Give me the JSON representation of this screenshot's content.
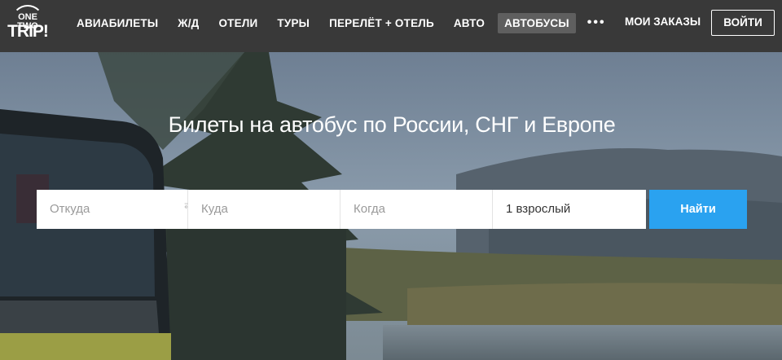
{
  "header": {
    "logo": {
      "line1": "ONE TWO",
      "line2": "TRIP!"
    },
    "nav": [
      {
        "label": "АВИАБИЛЕТЫ",
        "active": false
      },
      {
        "label": "Ж/Д",
        "active": false
      },
      {
        "label": "ОТЕЛИ",
        "active": false
      },
      {
        "label": "ТУРЫ",
        "active": false
      },
      {
        "label": "ПЕРЕЛЁТ + ОТЕЛЬ",
        "active": false
      },
      {
        "label": "АВТО",
        "active": false
      },
      {
        "label": "АВТОБУСЫ",
        "active": true
      }
    ],
    "more_icon": "more-dots-icon",
    "orders_label": "МОИ ЗАКАЗЫ",
    "login_label": "ВОЙТИ"
  },
  "hero": {
    "title": "Билеты на автобус по России, СНГ и Европе"
  },
  "search": {
    "from_placeholder": "Откуда",
    "to_placeholder": "Куда",
    "when_placeholder": "Когда",
    "passengers_value": "1 взрослый",
    "swap_icon": "swap-arrows-icon",
    "submit_label": "Найти"
  },
  "colors": {
    "header_bg": "#393939",
    "active_tab_bg": "#5f5f5f",
    "button_blue": "#2aa2f0"
  }
}
